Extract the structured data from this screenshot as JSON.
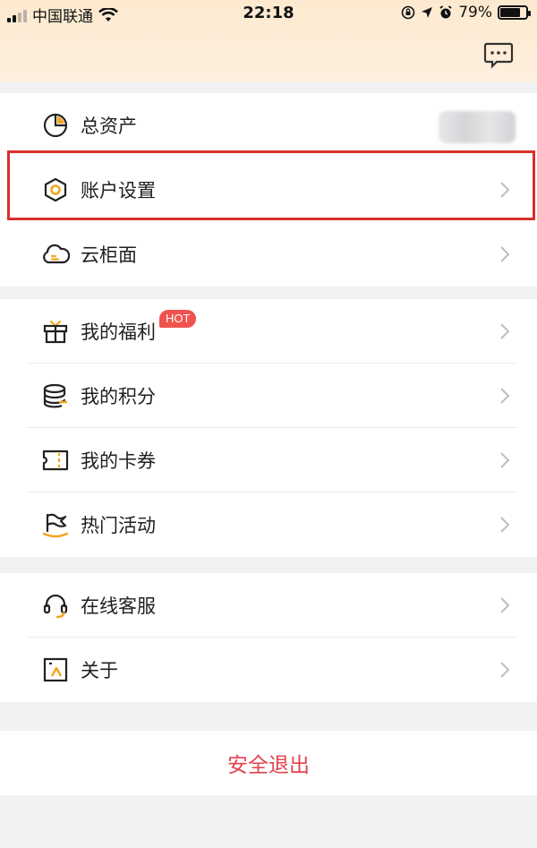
{
  "status_bar": {
    "carrier": "中国联通",
    "time": "22:18",
    "battery_percent": "79%",
    "battery_level": 0.79
  },
  "header": {
    "message_icon": "chat-bubble-icon"
  },
  "menu_group_1": [
    {
      "label": "总资产",
      "icon": "pie-chart-icon"
    },
    {
      "label": "账户设置",
      "icon": "hexagon-settings-icon"
    },
    {
      "label": "云柜面",
      "icon": "cloud-icon"
    }
  ],
  "menu_group_2": [
    {
      "label": "我的福利",
      "icon": "gift-icon",
      "badge": "HOT"
    },
    {
      "label": "我的积分",
      "icon": "coins-stack-icon"
    },
    {
      "label": "我的卡券",
      "icon": "ticket-icon"
    },
    {
      "label": "热门活动",
      "icon": "flag-icon"
    }
  ],
  "menu_group_3": [
    {
      "label": "在线客服",
      "icon": "headset-icon"
    },
    {
      "label": "关于",
      "icon": "info-frame-icon"
    }
  ],
  "logout_label": "安全退出",
  "colors": {
    "accent": "#f2a51f",
    "highlight_border": "#d9302a",
    "logout_text": "#e0434b",
    "hot_badge": "#f0524d",
    "header_bg": "#fde9cf"
  }
}
